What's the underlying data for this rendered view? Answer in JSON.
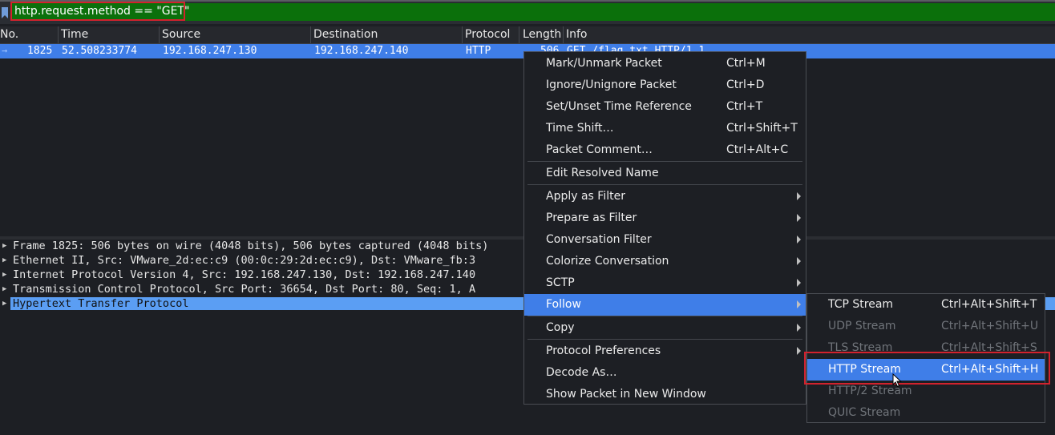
{
  "filter": {
    "value": "http.request.method == \"GET\"",
    "bar_color": "#0b700b"
  },
  "columns": [
    "No.",
    "Time",
    "Source",
    "Destination",
    "Protocol",
    "Length",
    "Info"
  ],
  "packet": {
    "no": "1825",
    "time": "52.508233774",
    "source": "192.168.247.130",
    "destination": "192.168.247.140",
    "protocol": "HTTP",
    "length": "506",
    "info": "GET /flag.txt HTTP/1.1"
  },
  "details": [
    "Frame 1825: 506 bytes on wire (4048 bits), 506 bytes captured (4048 bits)",
    "Ethernet II, Src: VMware_2d:ec:c9 (00:0c:29:2d:ec:c9), Dst: VMware_fb:3",
    "Internet Protocol Version 4, Src: 192.168.247.130, Dst: 192.168.247.140",
    "Transmission Control Protocol, Src Port: 36654, Dst Port: 80, Seq: 1, A",
    "Hypertext Transfer Protocol"
  ],
  "context_menu": {
    "items": [
      {
        "label": "Mark/Unmark Packet",
        "shortcut": "Ctrl+M"
      },
      {
        "label": "Ignore/Unignore Packet",
        "shortcut": "Ctrl+D"
      },
      {
        "label": "Set/Unset Time Reference",
        "shortcut": "Ctrl+T"
      },
      {
        "label": "Time Shift…",
        "shortcut": "Ctrl+Shift+T"
      },
      {
        "label": "Packet Comment…",
        "shortcut": "Ctrl+Alt+C"
      },
      {
        "label": "Edit Resolved Name",
        "shortcut": ""
      },
      {
        "label": "Apply as Filter",
        "shortcut": ""
      },
      {
        "label": "Prepare as Filter",
        "shortcut": ""
      },
      {
        "label": "Conversation Filter",
        "shortcut": ""
      },
      {
        "label": "Colorize Conversation",
        "shortcut": ""
      },
      {
        "label": "SCTP",
        "shortcut": ""
      },
      {
        "label": "Follow",
        "shortcut": ""
      },
      {
        "label": "Copy",
        "shortcut": ""
      },
      {
        "label": "Protocol Preferences",
        "shortcut": ""
      },
      {
        "label": "Decode As…",
        "shortcut": ""
      },
      {
        "label": "Show Packet in New Window",
        "shortcut": ""
      }
    ]
  },
  "follow_submenu": {
    "items": [
      {
        "label": "TCP Stream",
        "shortcut": "Ctrl+Alt+Shift+T"
      },
      {
        "label": "UDP Stream",
        "shortcut": "Ctrl+Alt+Shift+U"
      },
      {
        "label": "TLS Stream",
        "shortcut": "Ctrl+Alt+Shift+S"
      },
      {
        "label": "HTTP Stream",
        "shortcut": "Ctrl+Alt+Shift+H"
      },
      {
        "label": "HTTP/2 Stream",
        "shortcut": ""
      },
      {
        "label": "QUIC Stream",
        "shortcut": ""
      }
    ]
  },
  "colors": {
    "selection": "#3f7ee8",
    "highlight_box": "#d2222d",
    "tree_selection": "#5b9ef3"
  }
}
